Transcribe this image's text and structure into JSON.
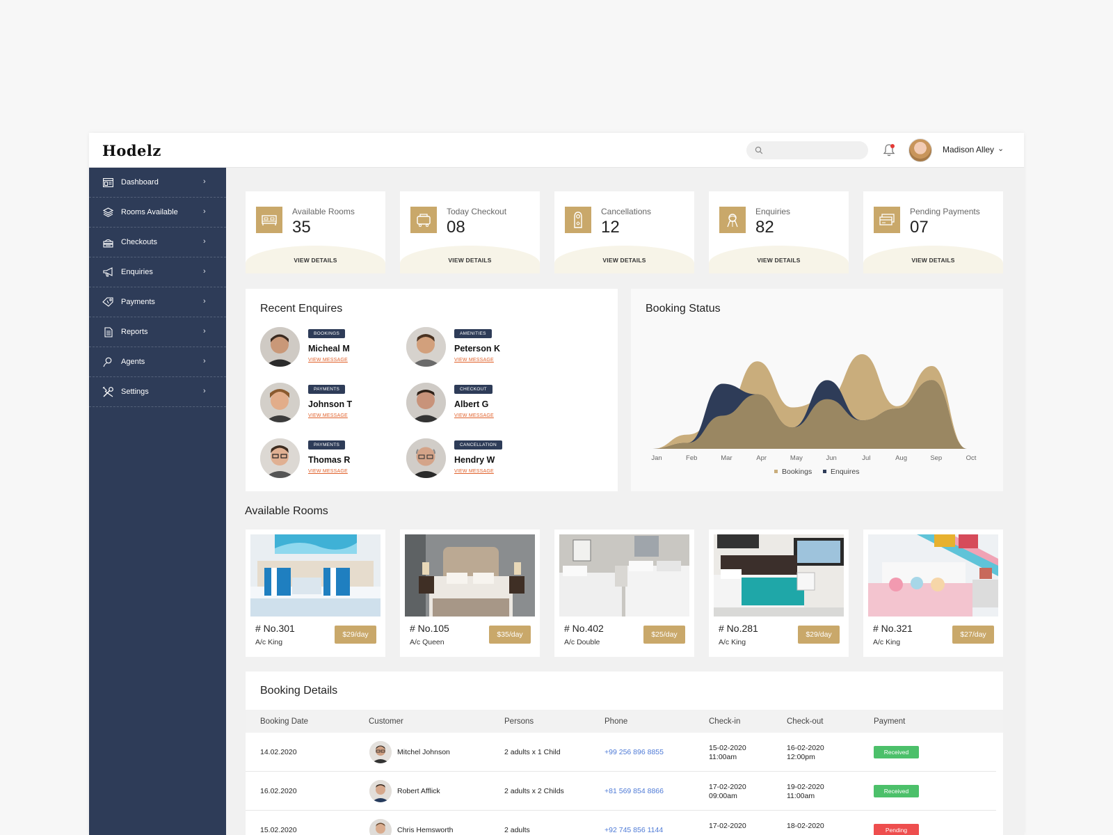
{
  "app": {
    "logo": "Hodelz"
  },
  "header": {
    "search_placeholder": "",
    "user_name": "Madison Alley"
  },
  "sidebar": {
    "items": [
      {
        "label": "Dashboard",
        "icon": "dashboard-icon"
      },
      {
        "label": "Rooms Available",
        "icon": "layers-icon"
      },
      {
        "label": "Checkouts",
        "icon": "cash-register-icon"
      },
      {
        "label": "Enquiries",
        "icon": "megaphone-icon"
      },
      {
        "label": "Payments",
        "icon": "tag-icon"
      },
      {
        "label": "Reports",
        "icon": "document-icon"
      },
      {
        "label": "Agents",
        "icon": "user-icon"
      },
      {
        "label": "Settings",
        "icon": "tools-icon"
      }
    ]
  },
  "stats": [
    {
      "label": "Available Rooms",
      "value": "35",
      "button": "VIEW DETAILS",
      "icon": "bed-icon"
    },
    {
      "label": "Today Checkout",
      "value": "08",
      "button": "VIEW DETAILS",
      "icon": "luggage-icon"
    },
    {
      "label": "Cancellations",
      "value": "12",
      "button": "VIEW DETAILS",
      "icon": "door-hanger-icon"
    },
    {
      "label": "Enquiries",
      "value": "82",
      "button": "VIEW DETAILS",
      "icon": "receptionist-icon"
    },
    {
      "label": "Pending Payments",
      "value": "07",
      "button": "VIEW DETAILS",
      "icon": "payment-icon"
    }
  ],
  "recent_enquires": {
    "title": "Recent Enquires",
    "items": [
      {
        "tag": "BOOKINGS",
        "name": "Micheal M",
        "link": "VIEW MESSAGE"
      },
      {
        "tag": "AMENITIES",
        "name": "Peterson K",
        "link": "VIEW MESSAGE"
      },
      {
        "tag": "PAYMENTS",
        "name": "Johnson T",
        "link": "VIEW MESSAGE"
      },
      {
        "tag": "CHECKOUT",
        "name": "Albert G",
        "link": "VIEW MESSAGE"
      },
      {
        "tag": "PAYMENTS",
        "name": "Thomas R",
        "link": "VIEW MESSAGE"
      },
      {
        "tag": "CANCELLATION",
        "name": "Hendry W",
        "link": "VIEW MESSAGE"
      }
    ]
  },
  "booking_status": {
    "title": "Booking Status",
    "colors": {
      "bookings": "#c9ad7c",
      "enquires": "#2e3c58",
      "overlap": "#9a8762"
    }
  },
  "chart_data": {
    "type": "area",
    "title": "Booking Status",
    "categories": [
      "Jan",
      "Feb",
      "Mar",
      "Apr",
      "May",
      "Jun",
      "Jul",
      "Aug",
      "Sep",
      "Oct"
    ],
    "series": [
      {
        "name": "Bookings",
        "values": [
          0,
          12,
          28,
          74,
          35,
          42,
          80,
          36,
          70,
          0
        ]
      },
      {
        "name": "Enquires",
        "values": [
          0,
          5,
          55,
          46,
          18,
          58,
          24,
          34,
          58,
          0
        ]
      }
    ],
    "legend": "bottom",
    "grid": false
  },
  "available_rooms": {
    "title": "Available Rooms",
    "rooms": [
      {
        "no": "# No.301",
        "type": "A/c King",
        "price": "$29/day"
      },
      {
        "no": "# No.105",
        "type": "A/c Queen",
        "price": "$35/day"
      },
      {
        "no": "# No.402",
        "type": "A/c Double",
        "price": "$25/day"
      },
      {
        "no": "# No.281",
        "type": "A/c King",
        "price": "$29/day"
      },
      {
        "no": "# No.321",
        "type": "A/c King",
        "price": "$27/day"
      }
    ]
  },
  "booking_details": {
    "title": "Booking Details",
    "columns": [
      "Booking Date",
      "Customer",
      "Persons",
      "Phone",
      "Check-in",
      "Check-out",
      "Payment"
    ],
    "rows": [
      {
        "date": "14.02.2020",
        "customer": "Mitchel Johnson",
        "persons": "2 adults x 1 Child",
        "phone": "+99 256 896 8855",
        "checkin_date": "15-02-2020",
        "checkin_time": "11:00am",
        "checkout_date": "16-02-2020",
        "checkout_time": "12:00pm",
        "payment": "Received",
        "payment_color": "#4cc06a"
      },
      {
        "date": "16.02.2020",
        "customer": "Robert Afflick",
        "persons": "2 adults x 2 Childs",
        "phone": "+81 569 854 8866",
        "checkin_date": "17-02-2020",
        "checkin_time": "09:00am",
        "checkout_date": "19-02-2020",
        "checkout_time": "11:00am",
        "payment": "Received",
        "payment_color": "#4cc06a"
      },
      {
        "date": "15.02.2020",
        "customer": "Chris Hemsworth",
        "persons": "2 adults",
        "phone": "+92 745 856 1144",
        "checkin_date": "17-02-2020",
        "checkin_time": "",
        "checkout_date": "18-02-2020",
        "checkout_time": "",
        "payment": "Pending",
        "payment_color": "#ee4e4e"
      }
    ]
  }
}
